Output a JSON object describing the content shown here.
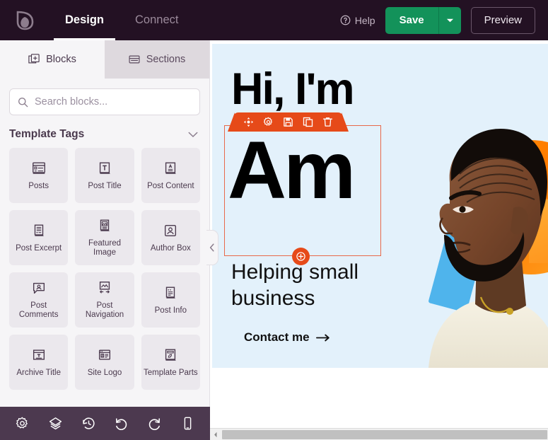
{
  "header": {
    "logo_name": "leaf-logo",
    "tabs": [
      {
        "label": "Design",
        "active": true
      },
      {
        "label": "Connect",
        "active": false
      }
    ],
    "help_label": "Help",
    "save_label": "Save",
    "save_dropdown_name": "chevron-down-icon",
    "preview_label": "Preview",
    "accent_save_color": "#13925a",
    "background_color": "#231123"
  },
  "sidebar": {
    "tabs": [
      {
        "label": "Blocks",
        "icon": "blocks-icon",
        "active": true
      },
      {
        "label": "Sections",
        "icon": "sections-icon",
        "active": false
      }
    ],
    "search": {
      "placeholder": "Search blocks...",
      "value": "",
      "icon": "search-icon"
    },
    "group": {
      "title": "Template Tags",
      "toggle_icon": "chevron-down-icon",
      "expanded": true
    },
    "blocks": [
      {
        "label": "Posts",
        "icon": "posts-icon"
      },
      {
        "label": "Post Title",
        "icon": "post-title-icon"
      },
      {
        "label": "Post Content",
        "icon": "post-content-icon"
      },
      {
        "label": "Post Excerpt",
        "icon": "post-excerpt-icon"
      },
      {
        "label": "Featured Image",
        "icon": "featured-image-icon"
      },
      {
        "label": "Author Box",
        "icon": "author-box-icon"
      },
      {
        "label": "Post Comments",
        "icon": "post-comments-icon"
      },
      {
        "label": "Post Navigation",
        "icon": "post-navigation-icon"
      },
      {
        "label": "Post Info",
        "icon": "post-info-icon"
      },
      {
        "label": "Archive Title",
        "icon": "archive-title-icon"
      },
      {
        "label": "Site Logo",
        "icon": "site-logo-icon"
      },
      {
        "label": "Template Parts",
        "icon": "template-parts-icon"
      }
    ],
    "bottom_toolbar": [
      {
        "name": "settings-icon"
      },
      {
        "name": "layers-icon"
      },
      {
        "name": "history-icon"
      },
      {
        "name": "undo-icon"
      },
      {
        "name": "redo-icon"
      },
      {
        "name": "responsive-mobile-icon"
      }
    ],
    "collapse_icon": "chevron-left-icon",
    "background_color": "#f6f5f7",
    "bottom_bar_color": "#4c394f"
  },
  "canvas": {
    "hero": {
      "background_color": "#e3f1fb",
      "headline_line1": "Hi, I'm",
      "headline_line2": "Am",
      "subheadline": "Helping small business",
      "cta_label": "Contact me",
      "cta_icon": "arrow-right-icon",
      "portrait_alt": "portrait-photo"
    },
    "selection": {
      "accent_color": "#e64a19",
      "toolbar_icons": [
        {
          "name": "move-icon"
        },
        {
          "name": "gear-icon"
        },
        {
          "name": "save-icon"
        },
        {
          "name": "duplicate-icon"
        },
        {
          "name": "trash-icon"
        }
      ],
      "add_icon": "plus-circle-icon"
    },
    "scrollbar": {
      "left_arrow_icon": "caret-left-icon"
    }
  }
}
